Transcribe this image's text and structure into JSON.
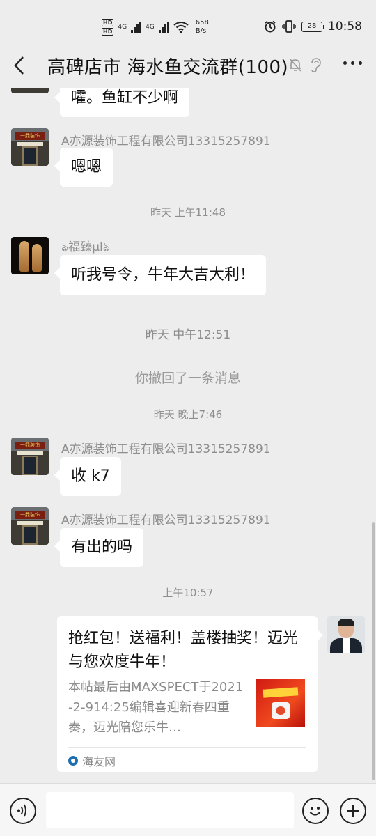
{
  "status_bar": {
    "hd1": "HD",
    "hd2": "HD",
    "net1": "4G",
    "net2": "4G",
    "speed_value": "658",
    "speed_unit": "B/s",
    "battery": "28",
    "time": "10:58",
    "icons": [
      "alarm-icon",
      "vibrate-icon",
      "battery-icon",
      "wifi-icon",
      "signal-icon"
    ]
  },
  "header": {
    "title": "高碑店市 海水鱼交流群(100)",
    "icons": [
      "back-icon",
      "mute-bell-icon",
      "ear-icon",
      "more-icon"
    ]
  },
  "messages": [
    {
      "text": "嚯。鱼缸不少啊"
    },
    {
      "sender": "A亦源装饰工程有限公司13315257891",
      "text": "嗯嗯",
      "avatar_sign": "一鼎装饰"
    },
    {
      "time": "昨天 上午11:48"
    },
    {
      "sender": "ঌ福臻µlঌ",
      "text": "听我号令，牛年大吉大利！"
    },
    {
      "time": "昨天 中午12:51"
    },
    {
      "system": "你撤回了一条消息"
    },
    {
      "time": "昨天 晚上7:46"
    },
    {
      "sender": "A亦源装饰工程有限公司13315257891",
      "text": "收 k7",
      "avatar_sign": "一鼎装饰"
    },
    {
      "sender": "A亦源装饰工程有限公司13315257891",
      "text": "有出的吗",
      "avatar_sign": "一鼎装饰"
    },
    {
      "time": "上午10:57"
    }
  ],
  "link_card": {
    "title": "抢红包！送福利！盖楼抽奖！迈光与您欢度牛年！",
    "description": "本帖最后由MAXSPECT于2021-2-914:25编辑喜迎新春四重奏，迈光陪您乐牛…",
    "source": "海友网"
  },
  "input_bar": {
    "placeholder": "",
    "icons": [
      "voice-icon",
      "emoji-icon",
      "plus-icon"
    ]
  }
}
